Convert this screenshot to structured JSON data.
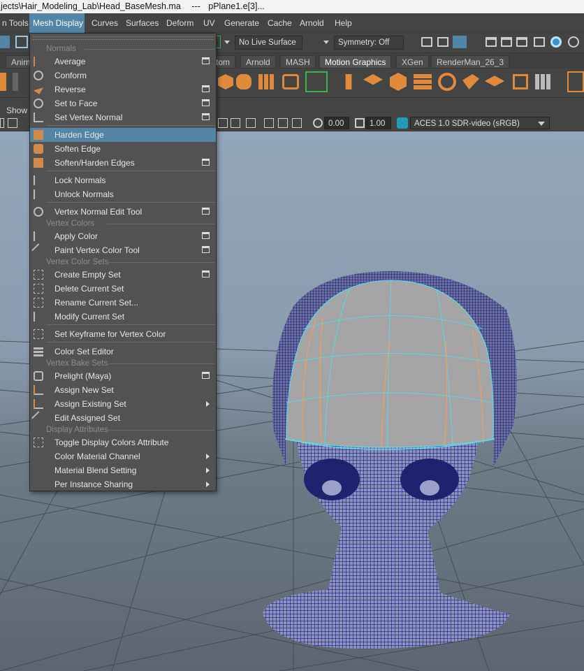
{
  "titlebar": {
    "path": "jects\\Hair_Modeling_Lab\\Head_BaseMesh.ma",
    "sep": "---",
    "object": "pPlane1.e[3]..."
  },
  "menubar": {
    "items": [
      "n Tools",
      "Mesh Display",
      "Curves",
      "Surfaces",
      "Deform",
      "UV",
      "Generate",
      "Cache",
      "Arnold",
      "Help"
    ],
    "active": "Mesh Display"
  },
  "statusline": {
    "live_surface": "No Live Surface",
    "symmetry": "Symmetry: Off"
  },
  "shelf_tabs": [
    "Anim",
    "tom",
    "Arnold",
    "MASH",
    "Motion Graphics",
    "XGen",
    "RenderMan_26_3"
  ],
  "panel": {
    "show_label": "Show",
    "exposure": "0.00",
    "gamma": "1.00",
    "colorspace": "ACES 1.0 SDR-video (sRGB)"
  },
  "menu": {
    "sections": {
      "normals": "Normals",
      "vertex_colors": "Vertex Colors",
      "vertex_color_sets": "Vertex Color Sets",
      "vertex_bake_sets": "Vertex Bake Sets",
      "display_attributes": "Display Attributes"
    },
    "items": {
      "average": "Average",
      "conform": "Conform",
      "reverse": "Reverse",
      "set_to_face": "Set to Face",
      "set_vertex_normal": "Set Vertex Normal",
      "harden_edge": "Harden Edge",
      "soften_edge": "Soften Edge",
      "soften_harden": "Soften/Harden Edges",
      "lock_normals": "Lock Normals",
      "unlock_normals": "Unlock Normals",
      "vertex_normal_edit_tool": "Vertex Normal Edit Tool",
      "apply_color": "Apply Color",
      "paint_vertex_color_tool": "Paint Vertex Color Tool",
      "create_empty_set": "Create Empty Set",
      "delete_current_set": "Delete Current Set",
      "rename_current_set": "Rename Current Set...",
      "modify_current_set": "Modify Current Set",
      "set_keyframe_vertex_color": "Set Keyframe for Vertex Color",
      "color_set_editor": "Color Set Editor",
      "prelight_maya": "Prelight (Maya)",
      "assign_new_set": "Assign New Set",
      "assign_existing_set": "Assign Existing Set",
      "edit_assigned_set": "Edit Assigned Set",
      "toggle_display_colors": "Toggle Display Colors Attribute",
      "color_material_channel": "Color Material Channel",
      "material_blend_setting": "Material Blend Setting",
      "per_instance_sharing": "Per Instance Sharing"
    },
    "highlighted": "Harden Edge"
  },
  "colors": {
    "accent": "#5285a6",
    "wireframe": "#1a1a8c",
    "selected_edge": "#5fd7e6",
    "hard_edge": "#f0a060"
  }
}
